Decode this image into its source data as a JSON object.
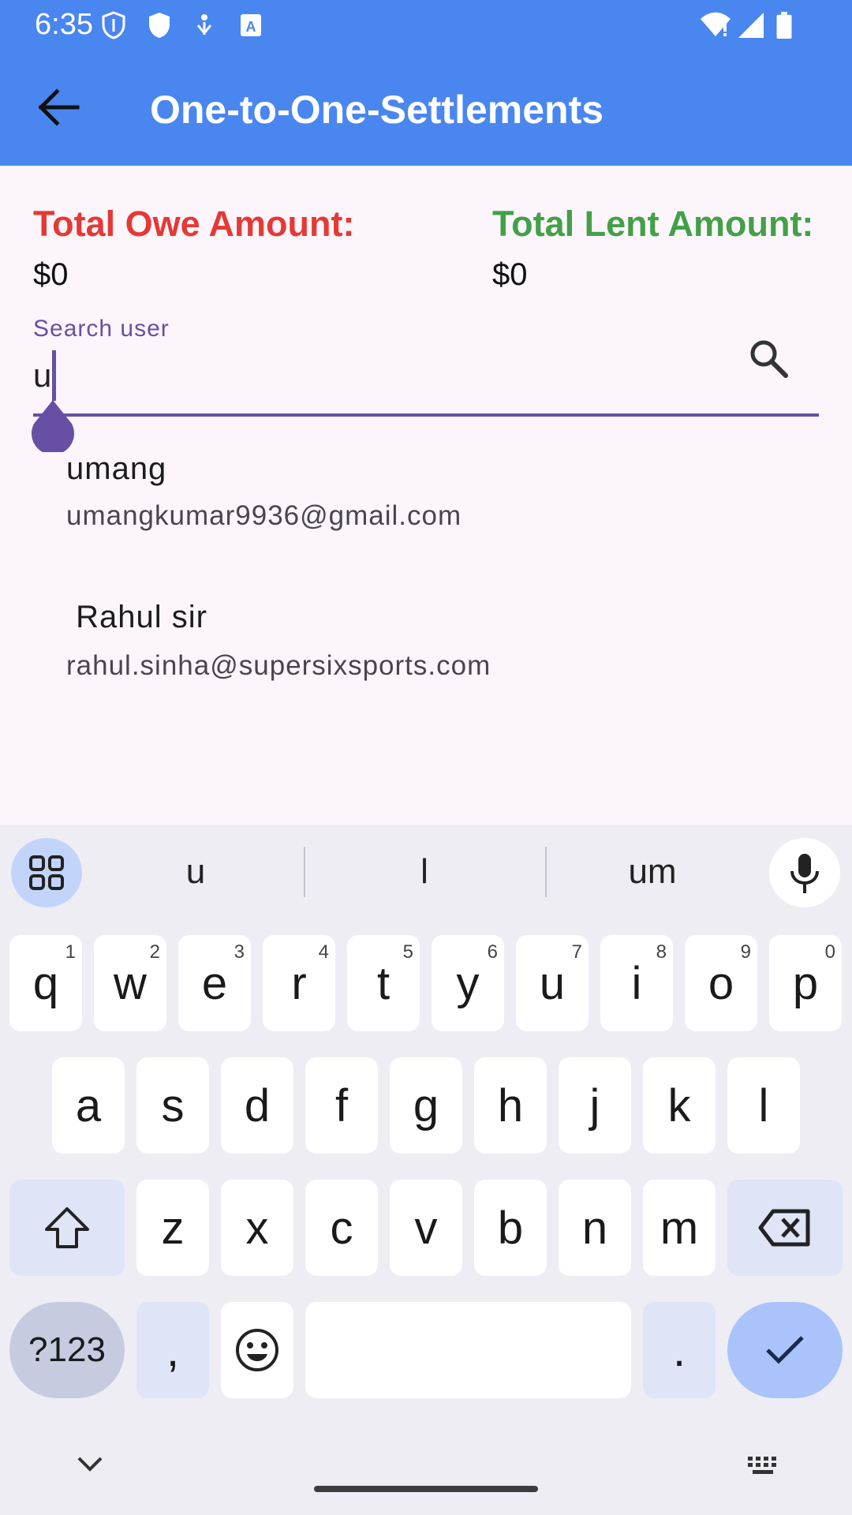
{
  "status_bar": {
    "time": "6:35"
  },
  "app_bar": {
    "title": "One-to-One-Settlements"
  },
  "totals": {
    "owe_label": "Total Owe Amount:",
    "owe_value": "$0",
    "lent_label": "Total Lent Amount:",
    "lent_value": "$0",
    "owe_color": "#e53935",
    "lent_color": "#43a047"
  },
  "search": {
    "label": "Search user",
    "value": "u"
  },
  "results": [
    {
      "name": "umang",
      "email": "umangkumar9936@gmail.com"
    },
    {
      "name": " Rahul sir",
      "email": "rahul.sinha@supersixsports.com"
    }
  ],
  "keyboard": {
    "suggestions": [
      "u",
      "l",
      "um"
    ],
    "row1": [
      {
        "key": "q",
        "sup": "1"
      },
      {
        "key": "w",
        "sup": "2"
      },
      {
        "key": "e",
        "sup": "3"
      },
      {
        "key": "r",
        "sup": "4"
      },
      {
        "key": "t",
        "sup": "5"
      },
      {
        "key": "y",
        "sup": "6"
      },
      {
        "key": "u",
        "sup": "7"
      },
      {
        "key": "i",
        "sup": "8"
      },
      {
        "key": "o",
        "sup": "9"
      },
      {
        "key": "p",
        "sup": "0"
      }
    ],
    "row2": [
      "a",
      "s",
      "d",
      "f",
      "g",
      "h",
      "j",
      "k",
      "l"
    ],
    "row3": [
      "z",
      "x",
      "c",
      "v",
      "b",
      "n",
      "m"
    ],
    "symbols_label": "?123",
    "comma_label": ",",
    "period_label": "."
  },
  "colors": {
    "app_bar": "#4a86f0",
    "accent": "#6750a4",
    "background": "#fcf5fb"
  }
}
